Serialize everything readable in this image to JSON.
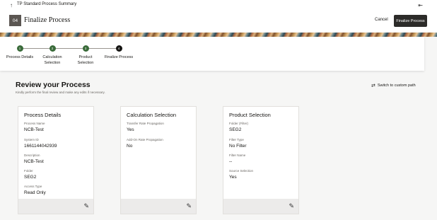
{
  "topbar": {
    "title": "TP Standard Process Summary",
    "back_icon": "↑",
    "collapse_icon": "⇤"
  },
  "header": {
    "step_badge": "04",
    "page_title": "Finalize Process",
    "cancel_label": "Cancel",
    "finalize_label": "Finalize Process"
  },
  "steps": [
    {
      "number": "1",
      "label_line1": "Process Details",
      "label_line2": "",
      "state": "done"
    },
    {
      "number": "2",
      "label_line1": "Calculation",
      "label_line2": "Selection",
      "state": "done"
    },
    {
      "number": "3",
      "label_line1": "Product",
      "label_line2": "Selection",
      "state": "done"
    },
    {
      "number": "4",
      "label_line1": "Finalize Process",
      "label_line2": "",
      "state": "current"
    }
  ],
  "review": {
    "title": "Review your Process",
    "subtitle": "Kindly perform the final review and make any edits if necessary.",
    "switch_label": "Switch to custom path",
    "switch_icon": "⇄"
  },
  "cards": [
    {
      "title": "Process Details",
      "fields": [
        {
          "label": "Process Name",
          "value": "NCB-Test"
        },
        {
          "label": "System ID",
          "value": "1661144042939"
        },
        {
          "label": "Description",
          "value": "NCB-Test"
        },
        {
          "label": "Folder",
          "value": "SEG2"
        },
        {
          "label": "Access Type",
          "value": "Read Only"
        }
      ]
    },
    {
      "title": "Calculation Selection",
      "fields": [
        {
          "label": "Transfer Rate Propagation",
          "value": "Yes"
        },
        {
          "label": "Add-On Rate Propagation",
          "value": "No"
        }
      ]
    },
    {
      "title": "Product Selection",
      "fields": [
        {
          "label": "Folder (Filter)",
          "value": "SEG2"
        },
        {
          "label": "Filter Type",
          "value": "No Filter"
        },
        {
          "label": "Filter Name",
          "value": "--"
        },
        {
          "label": "Source Selection",
          "value": "Yes"
        }
      ]
    }
  ],
  "edit_icon": "✎",
  "colors": {
    "primary_button": "#2c2b29",
    "step_done": "#3a6b3a",
    "step_current": "#161513"
  }
}
